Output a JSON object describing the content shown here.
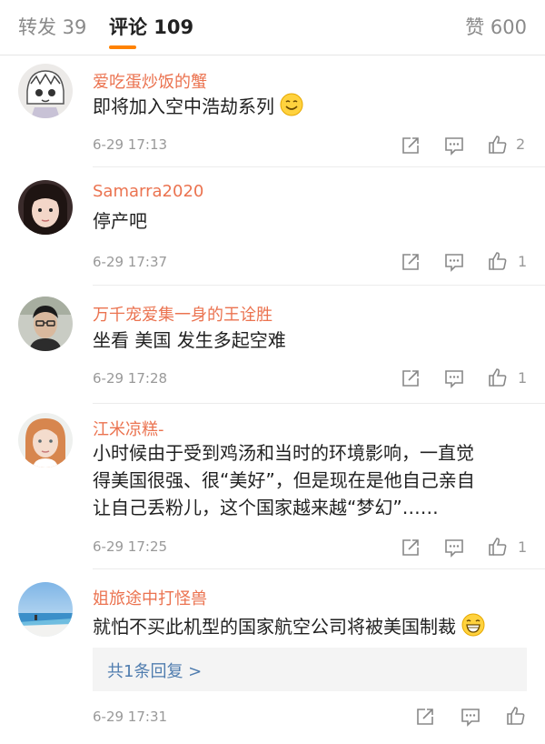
{
  "tabs": {
    "repost": "转发 39",
    "comments": "评论 109",
    "likes": "赞 600"
  },
  "comments": [
    {
      "username": "爱吃蛋炒饭的蟹",
      "lines": [
        "即将加入空中浩劫系列"
      ],
      "emoji": "smile-emoji",
      "time": "6-29 17:13",
      "likes": "2"
    },
    {
      "username": "Samarra2020",
      "lines": [
        "停产吧"
      ],
      "time": "6-29 17:37",
      "likes": "1"
    },
    {
      "username": "万千宠爱集一身的王诠胜",
      "lines": [
        "坐看 美国 发生多起空难"
      ],
      "time": "6-29 17:28",
      "likes": "1"
    },
    {
      "username": "江米凉糕-",
      "lines": [
        "小时候由于受到鸡汤和当时的环境影响，一直觉",
        "得美国很强、很“美好”，但是现在是他自己亲自",
        "让自己丢粉儿，这个国家越来越“梦幻”……"
      ],
      "time": "6-29 17:25",
      "likes": "1"
    },
    {
      "username": "姐旅途中打怪兽",
      "lines": [
        "就怕不买此机型的国家航空公司将被美国制裁"
      ],
      "emoji": "grin-emoji",
      "reply": "共1条回复 >",
      "time": "6-29 17:31",
      "likes": ""
    }
  ],
  "colors": {
    "accent": "#ff8200",
    "username": "#eb7350",
    "link": "#507daf"
  }
}
